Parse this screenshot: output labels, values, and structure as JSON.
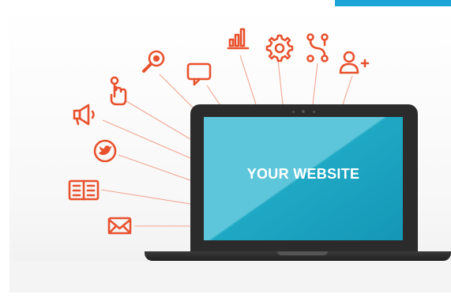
{
  "screen": {
    "text": "YOUR WEBSITE"
  },
  "icons": [
    "mail-icon",
    "newspaper-icon",
    "twitter-icon",
    "megaphone-icon",
    "click-icon",
    "search-icon",
    "chat-icon",
    "bar-chart-icon",
    "gear-icon",
    "network-icon",
    "add-user-icon"
  ],
  "colors": {
    "icon": "#e8512d",
    "line": "#f2a58f",
    "screen_light": "#5ec6da",
    "screen_dark": "#1497b6",
    "accent_bar": "#1ca6d8",
    "laptop": "#2b2b2b"
  }
}
